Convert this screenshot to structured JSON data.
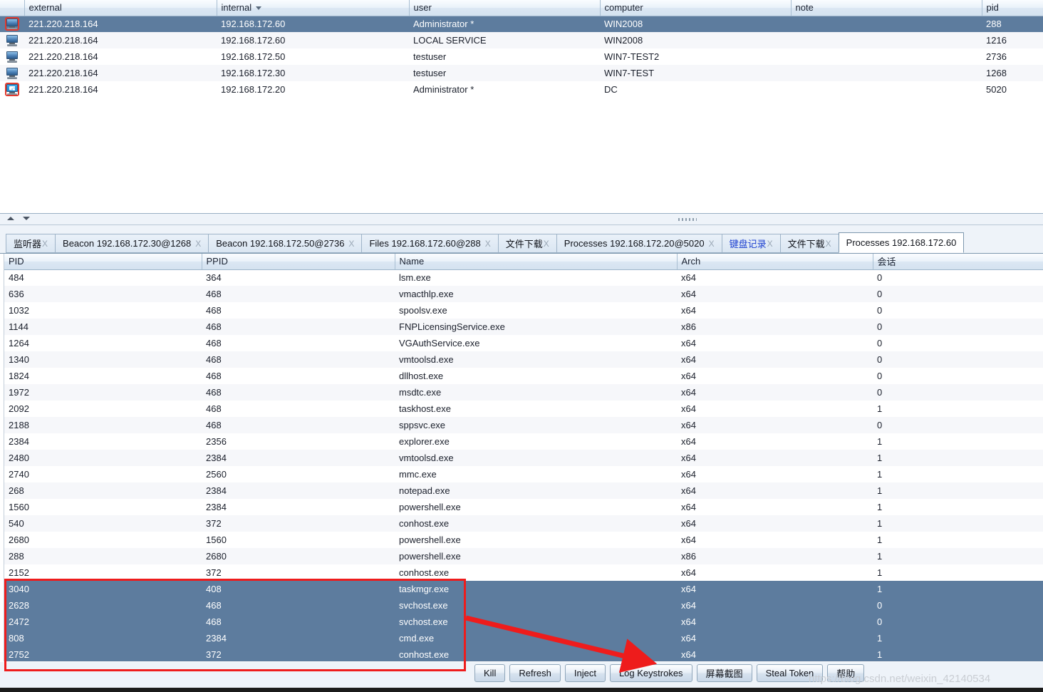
{
  "sessions": {
    "columns": [
      "external",
      "internal",
      "user",
      "computer",
      "note",
      "pid"
    ],
    "sorted_column": "internal",
    "rows": [
      {
        "icon": "computer-elevated-icon",
        "external": "221.220.218.164",
        "internal": "192.168.172.60",
        "user": "Administrator *",
        "computer": "WIN2008",
        "note": "",
        "pid": "288",
        "selected": true
      },
      {
        "icon": "computer-icon",
        "external": "221.220.218.164",
        "internal": "192.168.172.60",
        "user": "LOCAL SERVICE",
        "computer": "WIN2008",
        "note": "",
        "pid": "1216",
        "selected": false
      },
      {
        "icon": "computer-icon",
        "external": "221.220.218.164",
        "internal": "192.168.172.50",
        "user": "testuser",
        "computer": "WIN7-TEST2",
        "note": "",
        "pid": "2736",
        "selected": false
      },
      {
        "icon": "computer-icon",
        "external": "221.220.218.164",
        "internal": "192.168.172.30",
        "user": "testuser",
        "computer": "WIN7-TEST",
        "note": "",
        "pid": "1268",
        "selected": false
      },
      {
        "icon": "computer-windows-elevated-icon",
        "external": "221.220.218.164",
        "internal": "192.168.172.20",
        "user": "Administrator *",
        "computer": "DC",
        "note": "",
        "pid": "5020",
        "selected": false
      }
    ]
  },
  "tabs": [
    {
      "label": "监听器",
      "close": "X",
      "active": false,
      "highlight": false,
      "tight": true
    },
    {
      "label": "Beacon 192.168.172.30@1268",
      "close": "X",
      "active": false,
      "highlight": false,
      "tight": false
    },
    {
      "label": "Beacon 192.168.172.50@2736",
      "close": "X",
      "active": false,
      "highlight": false,
      "tight": false
    },
    {
      "label": "Files 192.168.172.60@288",
      "close": "X",
      "active": false,
      "highlight": false,
      "tight": false
    },
    {
      "label": "文件下载",
      "close": "X",
      "active": false,
      "highlight": false,
      "tight": true
    },
    {
      "label": "Processes 192.168.172.20@5020",
      "close": "X",
      "active": false,
      "highlight": false,
      "tight": false
    },
    {
      "label": "键盘记录",
      "close": "X",
      "active": false,
      "highlight": true,
      "tight": true
    },
    {
      "label": "文件下载",
      "close": "X",
      "active": false,
      "highlight": false,
      "tight": true
    },
    {
      "label": "Processes 192.168.172.60",
      "close": "",
      "active": true,
      "highlight": false,
      "tight": false
    }
  ],
  "processes": {
    "columns": [
      "PID",
      "PPID",
      "Name",
      "Arch",
      "会话"
    ],
    "rows": [
      {
        "pid": "484",
        "ppid": "364",
        "name": "lsm.exe",
        "arch": "x64",
        "session": "0",
        "selected": false
      },
      {
        "pid": "636",
        "ppid": "468",
        "name": "vmacthlp.exe",
        "arch": "x64",
        "session": "0",
        "selected": false
      },
      {
        "pid": "1032",
        "ppid": "468",
        "name": "spoolsv.exe",
        "arch": "x64",
        "session": "0",
        "selected": false
      },
      {
        "pid": "1144",
        "ppid": "468",
        "name": "FNPLicensingService.exe",
        "arch": "x86",
        "session": "0",
        "selected": false
      },
      {
        "pid": "1264",
        "ppid": "468",
        "name": "VGAuthService.exe",
        "arch": "x64",
        "session": "0",
        "selected": false
      },
      {
        "pid": "1340",
        "ppid": "468",
        "name": "vmtoolsd.exe",
        "arch": "x64",
        "session": "0",
        "selected": false
      },
      {
        "pid": "1824",
        "ppid": "468",
        "name": "dllhost.exe",
        "arch": "x64",
        "session": "0",
        "selected": false
      },
      {
        "pid": "1972",
        "ppid": "468",
        "name": "msdtc.exe",
        "arch": "x64",
        "session": "0",
        "selected": false
      },
      {
        "pid": "2092",
        "ppid": "468",
        "name": "taskhost.exe",
        "arch": "x64",
        "session": "1",
        "selected": false
      },
      {
        "pid": "2188",
        "ppid": "468",
        "name": "sppsvc.exe",
        "arch": "x64",
        "session": "0",
        "selected": false
      },
      {
        "pid": "2384",
        "ppid": "2356",
        "name": "explorer.exe",
        "arch": "x64",
        "session": "1",
        "selected": false
      },
      {
        "pid": "2480",
        "ppid": "2384",
        "name": "vmtoolsd.exe",
        "arch": "x64",
        "session": "1",
        "selected": false
      },
      {
        "pid": "2740",
        "ppid": "2560",
        "name": "mmc.exe",
        "arch": "x64",
        "session": "1",
        "selected": false
      },
      {
        "pid": "268",
        "ppid": "2384",
        "name": "notepad.exe",
        "arch": "x64",
        "session": "1",
        "selected": false
      },
      {
        "pid": "1560",
        "ppid": "2384",
        "name": "powershell.exe",
        "arch": "x64",
        "session": "1",
        "selected": false
      },
      {
        "pid": "540",
        "ppid": "372",
        "name": "conhost.exe",
        "arch": "x64",
        "session": "1",
        "selected": false
      },
      {
        "pid": "2680",
        "ppid": "1560",
        "name": "powershell.exe",
        "arch": "x64",
        "session": "1",
        "selected": false
      },
      {
        "pid": "288",
        "ppid": "2680",
        "name": "powershell.exe",
        "arch": "x86",
        "session": "1",
        "selected": false
      },
      {
        "pid": "2152",
        "ppid": "372",
        "name": "conhost.exe",
        "arch": "x64",
        "session": "1",
        "selected": false
      },
      {
        "pid": "3040",
        "ppid": "408",
        "name": "taskmgr.exe",
        "arch": "x64",
        "session": "1",
        "selected": true
      },
      {
        "pid": "2628",
        "ppid": "468",
        "name": "svchost.exe",
        "arch": "x64",
        "session": "0",
        "selected": true
      },
      {
        "pid": "2472",
        "ppid": "468",
        "name": "svchost.exe",
        "arch": "x64",
        "session": "0",
        "selected": true
      },
      {
        "pid": "808",
        "ppid": "2384",
        "name": "cmd.exe",
        "arch": "x64",
        "session": "1",
        "selected": true
      },
      {
        "pid": "2752",
        "ppid": "372",
        "name": "conhost.exe",
        "arch": "x64",
        "session": "1",
        "selected": true
      }
    ]
  },
  "buttons": [
    {
      "label": "Kill",
      "cjk": false
    },
    {
      "label": "Refresh",
      "cjk": false
    },
    {
      "label": "Inject",
      "cjk": false
    },
    {
      "label": "Log Keystrokes",
      "cjk": false
    },
    {
      "label": "屏幕截图",
      "cjk": true
    },
    {
      "label": "Steal Token",
      "cjk": false
    },
    {
      "label": "帮助",
      "cjk": true
    }
  ],
  "annotation": {
    "box_target": "selected-process-rows",
    "arrow_target": "Log Keystrokes",
    "color": "#ee1c1c"
  },
  "watermark": "https://blog.csdn.net/weixin_42140534",
  "colors": {
    "selection": "#5d7c9e",
    "header_top": "#fbfdff",
    "header_bottom": "#d4e2f0",
    "annotation_red": "#ee1c1c",
    "tab_highlight": "#1b3fd0"
  }
}
